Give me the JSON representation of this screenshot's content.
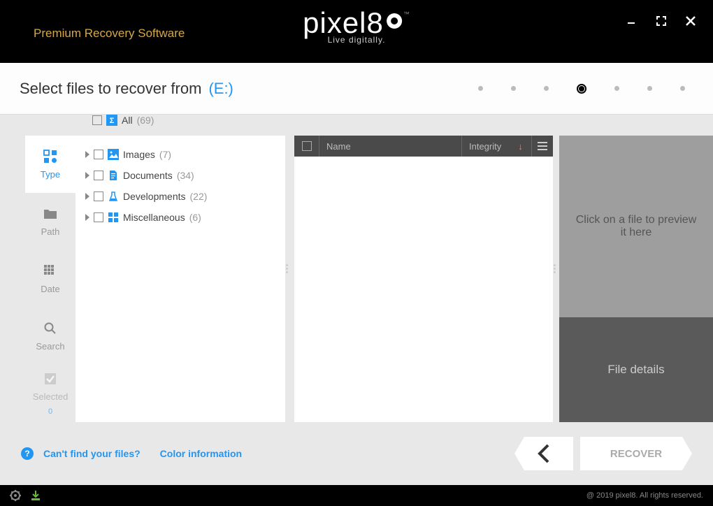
{
  "header": {
    "subtitle": "Premium Recovery Software",
    "logo": "pixel8",
    "tagline": "Live digitally."
  },
  "subheader": {
    "title": "Select files to recover from",
    "drive": "(E:)"
  },
  "sidetabs": {
    "type": "Type",
    "path": "Path",
    "date": "Date",
    "search": "Search",
    "selected": "Selected",
    "selected_count": "0"
  },
  "tree": {
    "all": {
      "label": "All",
      "count": "(69)"
    },
    "items": [
      {
        "label": "Images",
        "count": "(7)"
      },
      {
        "label": "Documents",
        "count": "(34)"
      },
      {
        "label": "Developments",
        "count": "(22)"
      },
      {
        "label": "Miscellaneous",
        "count": "(6)"
      }
    ]
  },
  "list_header": {
    "name": "Name",
    "integrity": "Integrity"
  },
  "preview": {
    "placeholder": "Click on a file to preview it here",
    "details_title": "File details"
  },
  "bottom": {
    "cant_find": "Can't find your files?",
    "color_info": "Color information",
    "recover": "RECOVER"
  },
  "footer": {
    "copy": "@ 2019 pixel8. All rights reserved."
  }
}
